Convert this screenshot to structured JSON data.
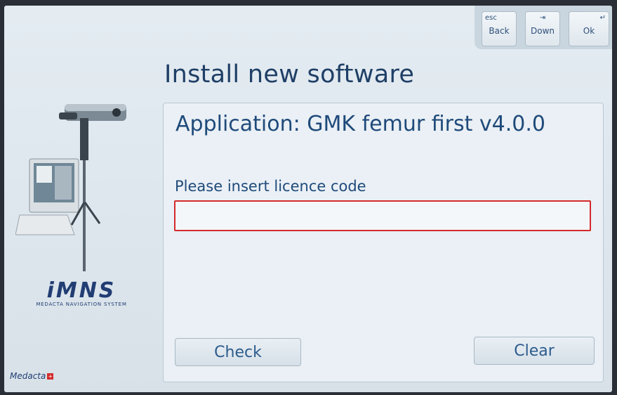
{
  "keys": {
    "back": {
      "hint": "esc",
      "label": "Back"
    },
    "down": {
      "hint": "⇥",
      "label": "Down"
    },
    "ok": {
      "hint": "↵",
      "label": "Ok"
    }
  },
  "page": {
    "title": "Install new software"
  },
  "panel": {
    "application": "Application: GMK femur first v4.0.0",
    "licence_label": "Please insert licence code",
    "licence_value": "",
    "check_label": "Check",
    "clear_label": "Clear"
  },
  "branding": {
    "product_logo": "iMNS",
    "product_tagline": "MEDACTA NAVIGATION SYSTEM",
    "company_logo": "Medacta"
  },
  "colors": {
    "accent": "#1f4a7a",
    "input_border": "#d42a2a"
  }
}
